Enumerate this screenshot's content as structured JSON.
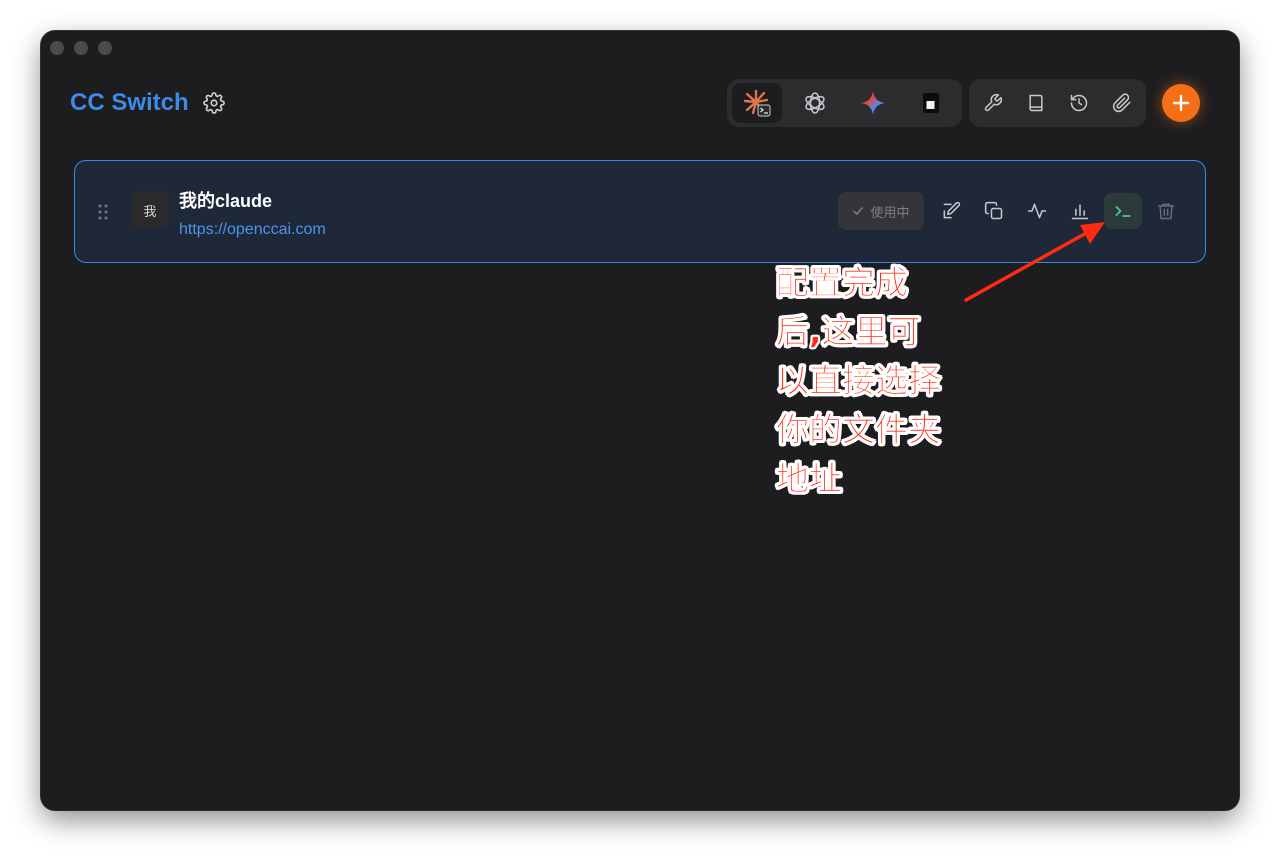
{
  "app": {
    "title": "CC Switch"
  },
  "app_switcher": [
    {
      "name": "claude-code",
      "icon": "claude-starburst-icon",
      "active": true
    },
    {
      "name": "codex",
      "icon": "openai-knot-icon",
      "active": false
    },
    {
      "name": "gemini",
      "icon": "gemini-sparkle-icon",
      "active": false
    },
    {
      "name": "terminal-app",
      "icon": "square-terminal-icon",
      "active": false
    }
  ],
  "toolbar": [
    "wrench-icon",
    "book-icon",
    "history-icon",
    "paperclip-icon"
  ],
  "add_button": {
    "icon": "plus-icon",
    "color": "#f56f18"
  },
  "provider": {
    "avatar": "我",
    "name": "我的claude",
    "url": "https://openccai.com",
    "status": "使用中",
    "actions": [
      "edit-icon",
      "copy-icon",
      "activity-icon",
      "bar-chart-icon",
      "terminal-icon",
      "trash-icon"
    ]
  },
  "annotation": {
    "text": "配置完成后,这里可以直接选择你的文件夹地址",
    "color": "#ff2a14"
  },
  "colors": {
    "accent": "#3b8ce8",
    "window_bg": "#1d1d1f",
    "card_border": "#3c86e8",
    "terminal_green": "#3fd28f"
  }
}
